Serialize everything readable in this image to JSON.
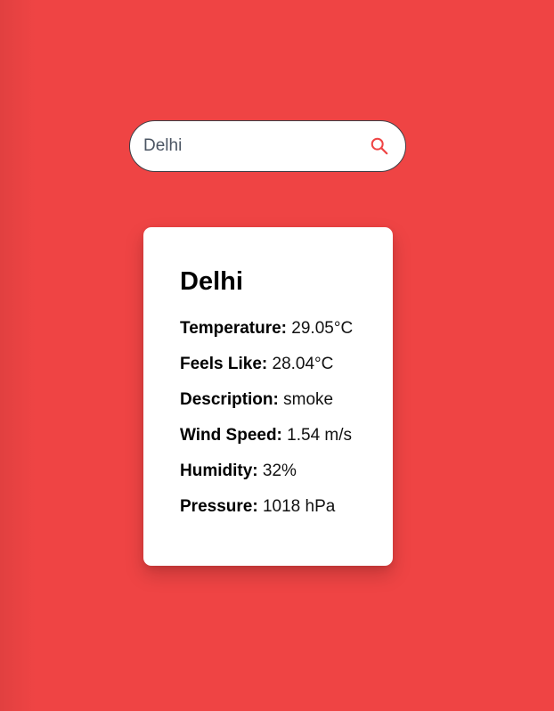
{
  "search": {
    "value": "Delhi",
    "icon": "search-icon",
    "icon_color": "#ef4444"
  },
  "theme": {
    "background": "#ef4444",
    "card_background": "#ffffff"
  },
  "weather": {
    "city": "Delhi",
    "rows": [
      {
        "label": "Temperature:",
        "value": "29.05°C"
      },
      {
        "label": "Feels Like:",
        "value": "28.04°C"
      },
      {
        "label": "Description:",
        "value": "smoke"
      },
      {
        "label": "Wind Speed:",
        "value": "1.54 m/s"
      },
      {
        "label": "Humidity:",
        "value": "32%"
      },
      {
        "label": "Pressure:",
        "value": "1018 hPa"
      }
    ]
  }
}
